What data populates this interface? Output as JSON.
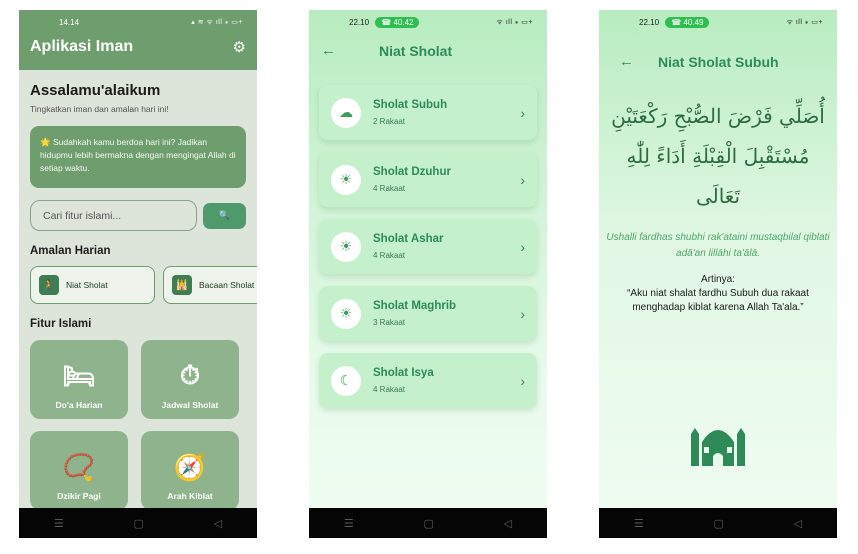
{
  "nav": {
    "menu": "☰",
    "home": "▢",
    "back": "◁"
  },
  "screen1": {
    "status": {
      "time": "14.14",
      "icons": "▴ ≋ ᯤ ıll ⁎ ▭+"
    },
    "app_title": "Aplikasi Iman",
    "greeting": "Assalamu'alaikum",
    "subgreeting": "Tingkatkan iman dan amalan hari ini!",
    "tip": "🌟 Sudahkah kamu berdoa hari ini? Jadikan hidupmu lebih bermakna dengan mengingat Allah di setiap waktu.",
    "search_placeholder": "Cari fitur islami...",
    "search_button": "🔍",
    "section_daily": "Amalan Harian",
    "daily": [
      {
        "label": "Niat Sholat",
        "icon": "🧎"
      },
      {
        "label": "Bacaan Sholat",
        "icon": "🕌"
      }
    ],
    "section_features": "Fitur Islami",
    "features": [
      {
        "label": "Do'a Harian",
        "icon": "🛏"
      },
      {
        "label": "Jadwal Sholat",
        "icon": "⏱"
      },
      {
        "label": "Dzikir Pagi",
        "icon": "📿"
      },
      {
        "label": "Arah Kiblat",
        "icon": "🧭"
      }
    ]
  },
  "screen2": {
    "status": {
      "time": "22.10",
      "call": "☎ 40.42",
      "icons": "ᯤ ıll ⁎ ▭+"
    },
    "title": "Niat Sholat",
    "prayers": [
      {
        "name": "Sholat Subuh",
        "rakaat": "2 Rakaat",
        "icon": "☁"
      },
      {
        "name": "Sholat Dzuhur",
        "rakaat": "4 Rakaat",
        "icon": "☀"
      },
      {
        "name": "Sholat Ashar",
        "rakaat": "4 Rakaat",
        "icon": "☀"
      },
      {
        "name": "Sholat Maghrib",
        "rakaat": "3 Rakaat",
        "icon": "☀"
      },
      {
        "name": "Sholat Isya",
        "rakaat": "4 Rakaat",
        "icon": "☾"
      }
    ]
  },
  "screen3": {
    "status": {
      "time": "22.10",
      "call": "☎ 40.49",
      "icons": "ᯤ ıll ⁎ ▭+"
    },
    "title": "Niat Sholat Subuh",
    "arabic_line1": "أُصَلِّي فَرْضَ الصُّبْحِ رَكْعَتَيْنِ",
    "arabic_line2": "مُسْتَقْبِلَ الْقِبْلَةِ أَدَاءً لِلّٰهِ تَعَالَى",
    "latin": "Ushalli fardhas shubhi rak'ataini mustaqbilal qiblati adā'an lillāhi ta'ālā.",
    "artinya_label": "Artinya:",
    "artinya": "“Aku niat shalat fardhu Subuh dua rakaat menghadap kiblat karena Allah Ta'ala.”"
  }
}
